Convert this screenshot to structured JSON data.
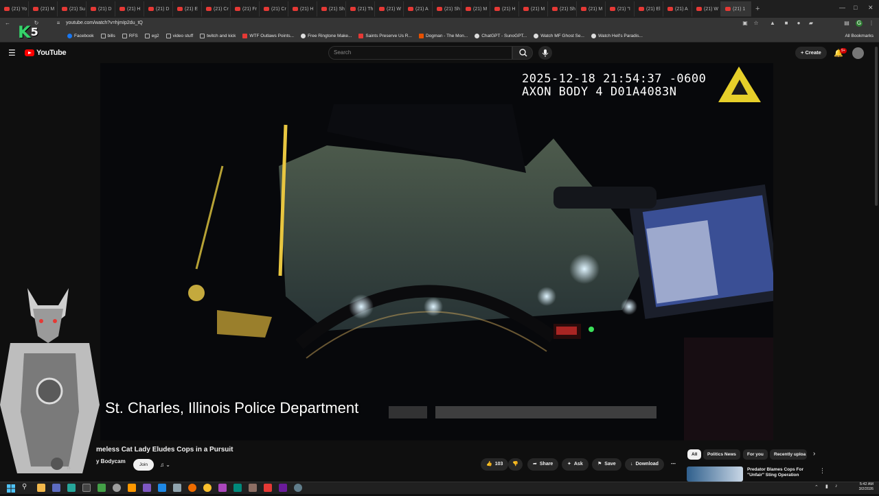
{
  "browser": {
    "tabs": [
      "(21) Yo",
      "(21) M",
      "(21) Su",
      "(21) D",
      "(21) H",
      "(21) D",
      "(21) E",
      "(21) Cr",
      "(21) Fr",
      "(21) Cr",
      "(21) H",
      "(21) Sh",
      "(21) Th",
      "(21) W",
      "(21) A",
      "(21) Sh",
      "(21) M",
      "(21) H",
      "(21) M",
      "(21) Sh",
      "(21) M",
      "(21) \"I",
      "(21) El",
      "(21) A",
      "(21) W",
      "(21) 1"
    ],
    "url": "youtube.com/watch?v=hjmIp2du_tQ",
    "bookmarks": [
      {
        "label": "Facebook",
        "icon": "fb"
      },
      {
        "label": "bills",
        "icon": "folder"
      },
      {
        "label": "RFS",
        "icon": "folder"
      },
      {
        "label": "eg2",
        "icon": "folder"
      },
      {
        "label": "video stuff",
        "icon": "folder"
      },
      {
        "label": "twitch and kick",
        "icon": "folder"
      },
      {
        "label": "WTF Outlaws Points...",
        "icon": "red"
      },
      {
        "label": "Free Ringtone Make...",
        "icon": "wh"
      },
      {
        "label": "Saints Preserve Us R...",
        "icon": "red"
      },
      {
        "label": "Dogman - The Mon...",
        "icon": "org"
      },
      {
        "label": "ChatGPT - SunoGPT...",
        "icon": "wh"
      },
      {
        "label": "Watch MF Ghost Se...",
        "icon": "wh"
      },
      {
        "label": "Watch Hell's Paradis...",
        "icon": "wh"
      }
    ],
    "all_bookmarks": "All Bookmarks"
  },
  "youtube": {
    "logo_text": "YouTube",
    "search_placeholder": "Search",
    "create_label": "Create",
    "notif_badge": "9+"
  },
  "video": {
    "timestamp_line1": "2025-12-18 21:54:37 -0600",
    "timestamp_line2": "AXON BODY 4 D01A4083N",
    "caption": "St. Charles, Illinois Police Department"
  },
  "info": {
    "title": "meless Cat Lady Eludes Cops in a Pursuit",
    "channel": "y Bodycam",
    "subs": "15",
    "join": "Join",
    "likes": "103",
    "share": "Share",
    "ask": "Ask",
    "save": "Save",
    "download": "Download"
  },
  "chips": [
    "All",
    "Politics News",
    "For you",
    "Recently uploa"
  ],
  "recommendation": {
    "title": "Predator Blames Cops For \"Unfair\" Sting Operation"
  },
  "overlay": {
    "logo_letter": "K",
    "logo_num": "5"
  },
  "taskbar": {
    "time": "5:42 AM",
    "date": "3/2/2026"
  }
}
